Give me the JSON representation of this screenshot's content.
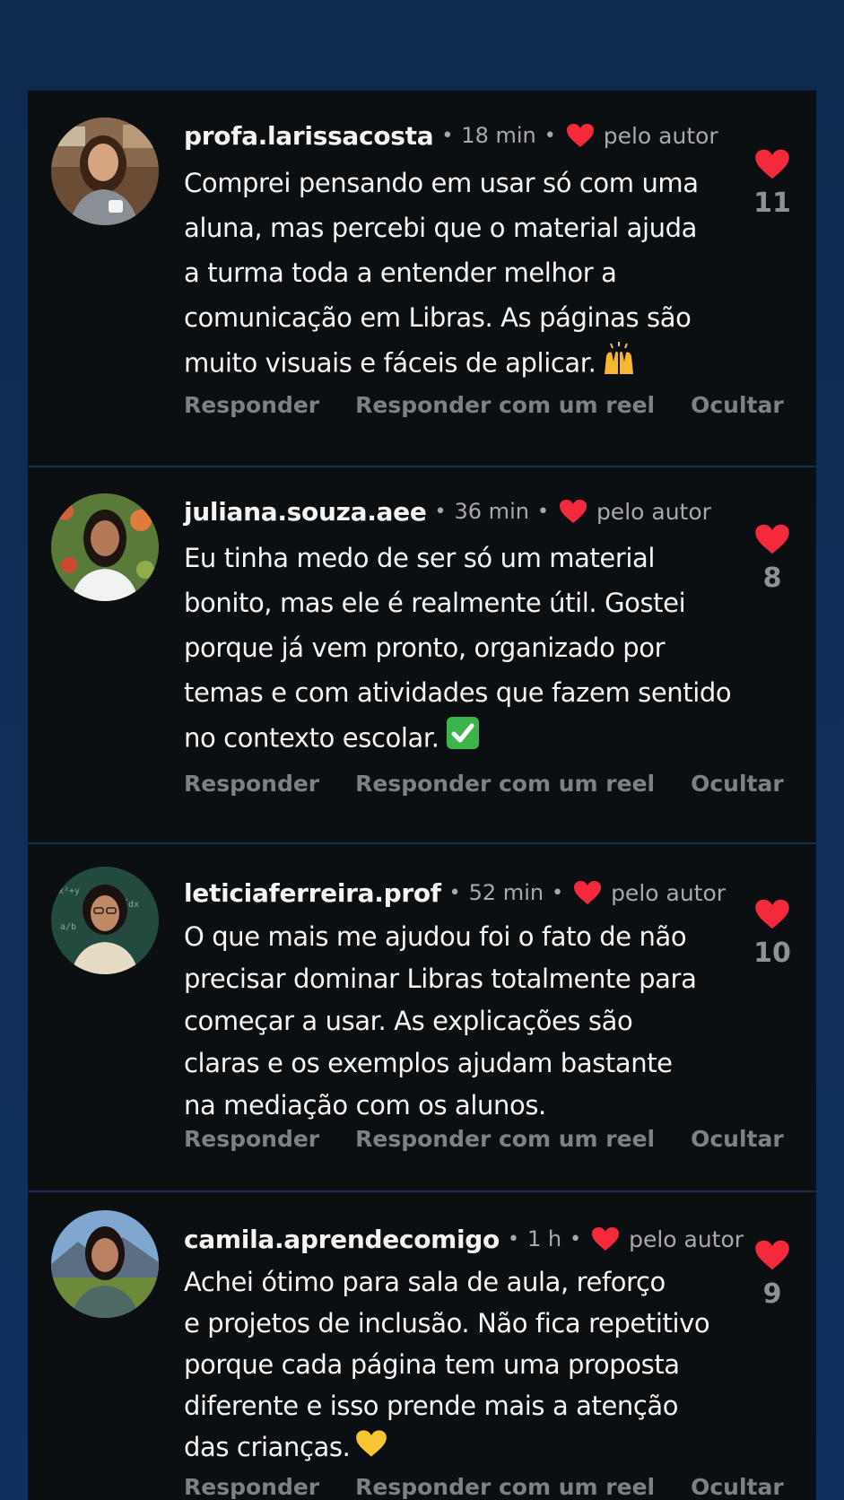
{
  "colors": {
    "heart": "#f42a3c",
    "panel_bg": "#0c0f12",
    "page_bg": "#0f2d56"
  },
  "comments": [
    {
      "username": "profa.larissacosta",
      "time": "18 min",
      "author_label": "pelo autor",
      "lines": [
        "Comprei pensando em usar só com uma",
        "aluna, mas percebi que o material ajuda",
        "a turma toda a entender melhor a",
        "comunicação em Libras. As páginas são",
        "muito visuais e fáceis de aplicar."
      ],
      "emoji": "raising-hands-icon",
      "likes": "11",
      "actions": {
        "reply": "Responder",
        "reel": "Responder com um reel",
        "hide": "Ocultar"
      }
    },
    {
      "username": "juliana.souza.aee",
      "time": "36 min",
      "author_label": "pelo autor",
      "lines": [
        "Eu tinha medo de ser só um material",
        "bonito, mas ele é realmente útil. Gostei",
        "porque já vem pronto, organizado por",
        "temas e com atividades que fazem sentido",
        "no contexto escolar."
      ],
      "emoji": "check-mark-icon",
      "likes": "8",
      "actions": {
        "reply": "Responder",
        "reel": "Responder com um reel",
        "hide": "Ocultar"
      }
    },
    {
      "username": "leticiaferreira.prof",
      "time": "52 min",
      "author_label": "pelo autor",
      "lines": [
        "O que mais me ajudou foi o fato de não",
        "precisar dominar Libras totalmente para",
        "começar a usar. As explicações são",
        "claras e os exemplos ajudam bastante",
        "na mediação com os alunos."
      ],
      "emoji": "",
      "likes": "10",
      "actions": {
        "reply": "Responder",
        "reel": "Responder com um reel",
        "hide": "Ocultar"
      }
    },
    {
      "username": "camila.aprendecomigo",
      "time": "1 h",
      "author_label": "pelo autor",
      "lines": [
        "Achei ótimo para sala de aula, reforço",
        "e projetos de inclusão. Não fica repetitivo",
        "porque cada página tem uma proposta",
        "diferente e isso prende mais a atenção",
        "das crianças."
      ],
      "emoji": "yellow-heart-icon",
      "likes": "9",
      "actions": {
        "reply": "Responder",
        "reel": "Responder com um reel",
        "hide": "Ocultar"
      }
    }
  ]
}
